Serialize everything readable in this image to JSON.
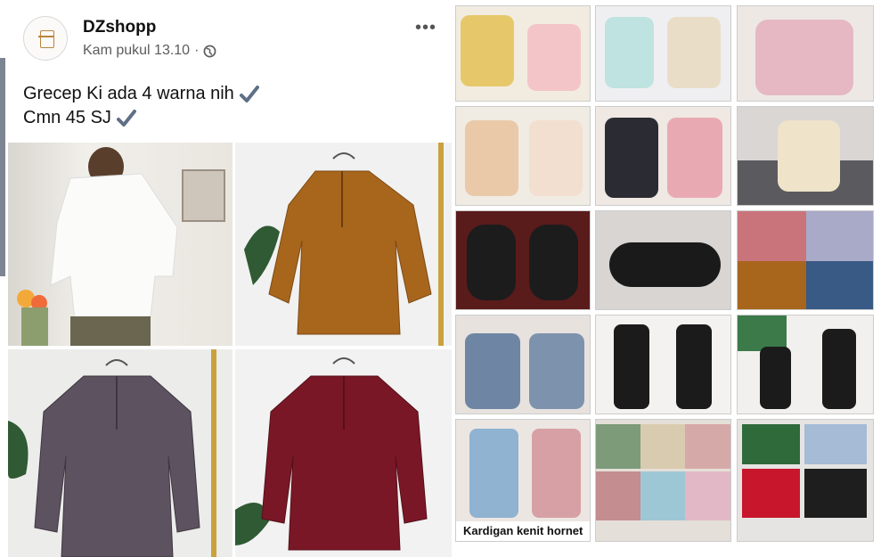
{
  "post": {
    "page_name": "DZshopp",
    "timestamp": "Kam pukul 13.10",
    "separator": "·",
    "privacy_icon": "globe-icon",
    "more_label": "•••",
    "caption_line1": "Grecep Ki ada 4 warna nih",
    "caption_line2": "Cmn 45 SJ",
    "check_icon": "checkmark-icon"
  },
  "photos": [
    {
      "name": "photo-white-blouse",
      "color": "#f4f4f2"
    },
    {
      "name": "photo-brown-blouse",
      "color": "#a8661d"
    },
    {
      "name": "photo-grey-blouse",
      "color": "#5d5360"
    },
    {
      "name": "photo-maroon-blouse",
      "color": "#7a1726"
    }
  ],
  "right_caption": "Kardigan kenit hornet",
  "colors": {
    "accent": "#1877f2",
    "brown": "#a8661d",
    "maroon": "#7a1726",
    "grey": "#5d5360"
  }
}
